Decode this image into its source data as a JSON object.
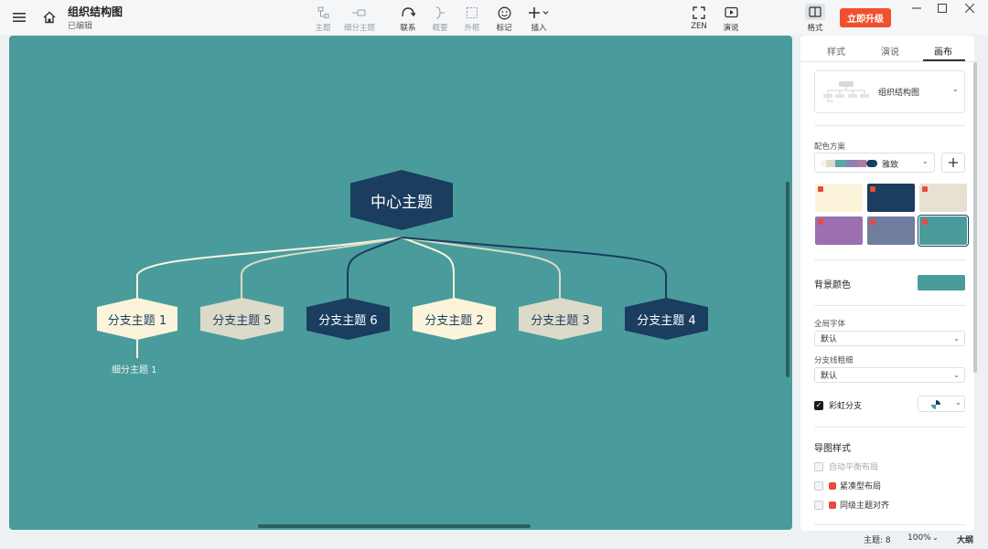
{
  "header": {
    "menu_icon": "hamburger-menu-icon",
    "home_icon": "home-icon",
    "title": "组织结构图",
    "subtitle": "已编辑"
  },
  "toolbar": {
    "topic": "主题",
    "subtopic": "细分主题",
    "relation": "联系",
    "summary": "概要",
    "boundary": "外框",
    "marker": "标记",
    "insert": "插入",
    "zen": "ZEN",
    "present": "演说",
    "format": "格式",
    "upgrade": "立即升级"
  },
  "map": {
    "center": "中心主题",
    "branches": [
      "分支主题 1",
      "分支主题 5",
      "分支主题 6",
      "分支主题 2",
      "分支主题 3",
      "分支主题 4"
    ],
    "subtopic": "细分主题 1"
  },
  "panel": {
    "tabs": [
      "样式",
      "演说",
      "画布"
    ],
    "active_tab": "画布",
    "structure": "组织结构图",
    "color_scheme_label": "配色方案",
    "color_scheme_value": "雅致",
    "bg_color_label": "背景颜色",
    "bg_color": "#4a9c9c",
    "global_font_label": "全局字体",
    "global_font_value": "默认",
    "branch_width_label": "分支线粗细",
    "branch_width_value": "默认",
    "rainbow_label": "彩虹分支",
    "map_style_title": "导图样式",
    "auto_balance": "自动平衡布局",
    "compact": "紧凑型布局",
    "align": "同级主题对齐"
  },
  "status": {
    "topics": "主题: 8",
    "zoom": "100%",
    "outline": "大纲"
  },
  "colors": {
    "canvas_bg": "#4a9c9c",
    "node_dark": "#1b3d5f",
    "node_light": "#fbf4db",
    "node_beige": "#dcdac9",
    "upgrade_btn": "#f0502d"
  }
}
